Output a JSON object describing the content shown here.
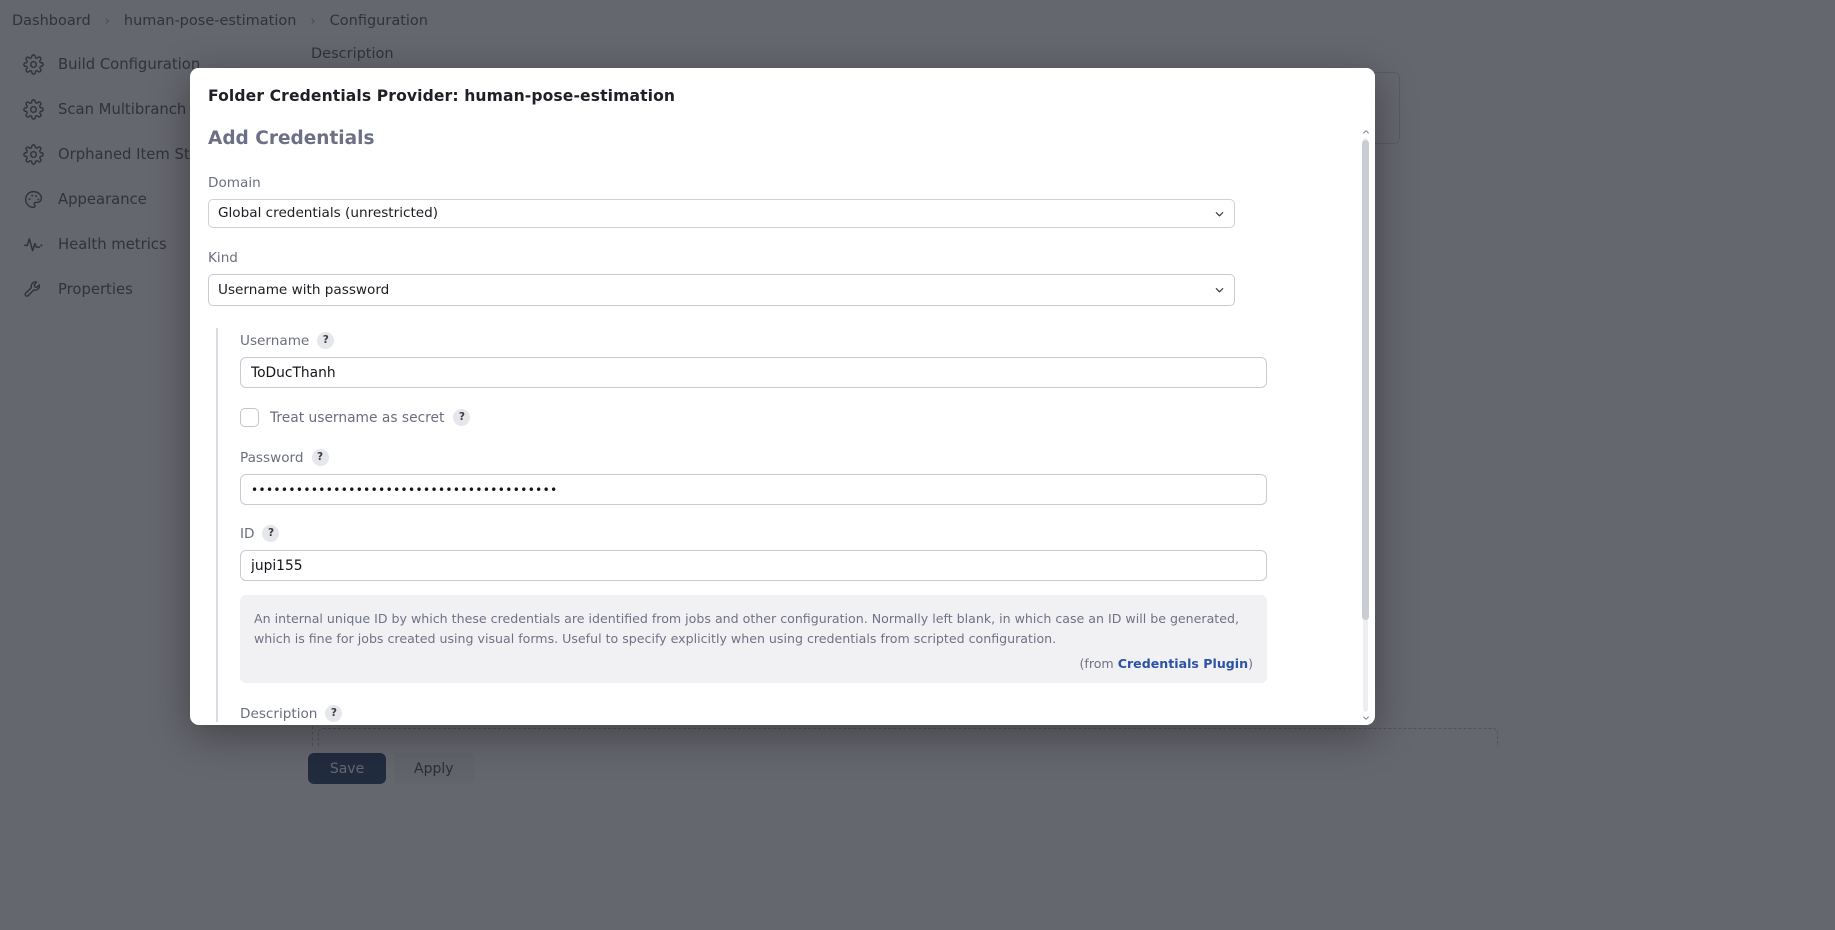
{
  "breadcrumb": {
    "items": [
      {
        "label": "Dashboard"
      },
      {
        "label": "human-pose-estimation"
      },
      {
        "label": "Configuration"
      }
    ],
    "separator": "›"
  },
  "sidebar": {
    "items": [
      {
        "label": "Build Configuration",
        "icon": "gear-icon"
      },
      {
        "label": "Scan Multibranch Pipeline Triggers",
        "icon": "gear-icon"
      },
      {
        "label": "Orphaned Item Strategy",
        "icon": "gear-icon"
      },
      {
        "label": "Appearance",
        "icon": "palette-icon"
      },
      {
        "label": "Health metrics",
        "icon": "pulse-icon"
      },
      {
        "label": "Properties",
        "icon": "wrench-icon"
      }
    ]
  },
  "background": {
    "description_label": "Description",
    "save_label": "Save",
    "apply_label": "Apply"
  },
  "modal": {
    "title": "Folder Credentials Provider: human-pose-estimation",
    "section_title": "Add Credentials",
    "domain": {
      "label": "Domain",
      "value": "Global credentials (unrestricted)",
      "options": [
        "Global credentials (unrestricted)"
      ]
    },
    "kind": {
      "label": "Kind",
      "value": "Username with password",
      "options": [
        "Username with password"
      ]
    },
    "username": {
      "label": "Username",
      "help": "?",
      "value": "ToDucThanh"
    },
    "treat_secret": {
      "label": "Treat username as secret",
      "help": "?",
      "checked": false
    },
    "password": {
      "label": "Password",
      "help": "?",
      "value": "•••••••••••••••••••••••••••••••••••••••••"
    },
    "id": {
      "label": "ID",
      "help": "?",
      "value": "jupi155",
      "description": "An internal unique ID by which these credentials are identified from jobs and other configuration. Normally left blank, in which case an ID will be generated, which is fine for jobs created using visual forms. Useful to specify explicitly when using credentials from scripted configuration.",
      "from_prefix": "(from ",
      "from_link": "Credentials Plugin",
      "from_suffix": ")"
    },
    "description": {
      "label": "Description",
      "help": "?"
    }
  },
  "colors": {
    "primary_button": "#1f3b63",
    "link": "#2c53a5",
    "label_text": "#6b6e82",
    "overlay": "rgba(36,38,48,0.70)"
  }
}
